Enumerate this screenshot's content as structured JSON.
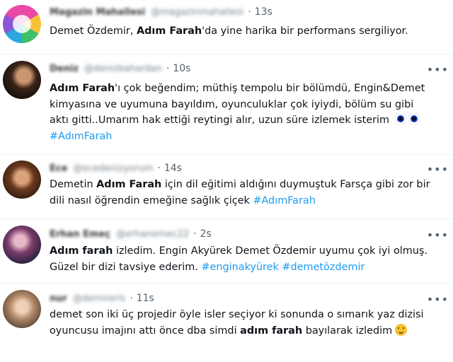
{
  "tweets": [
    {
      "name": "Magazin Mahallesi",
      "handle": "@magazinmahallesi",
      "time": "13s",
      "lines": [
        [
          {
            "t": "Demet Özdemir, "
          },
          {
            "t": "Adım Farah",
            "b": true
          },
          {
            "t": "'da yine harika bir performans sergiliyor."
          }
        ]
      ]
    },
    {
      "name": "Deniz",
      "handle": "@denizbahardan",
      "time": "10s",
      "lines": [
        [
          {
            "t": "Adım Farah",
            "b": true
          },
          {
            "t": "'ı çok beğendim; müthiş tempolu bir bölümdü, Engin&Demet"
          }
        ],
        [
          {
            "t": "kimyasına ve uyumuna bayıldım, oyunculuklar çok iyiydi, bölüm su gibi"
          }
        ],
        [
          {
            "t": "aktı gitti..Umarım hak ettiği reytingi alır, uzun süre izlemek isterim "
          },
          {
            "emoji": "nazar"
          },
          {
            "emoji": "nazar"
          }
        ],
        [
          {
            "t": "#AdımFarah",
            "tag": true
          }
        ]
      ]
    },
    {
      "name": "Ece",
      "handle": "@ecedenizyorum",
      "time": "14s",
      "lines": [
        [
          {
            "t": "Demetin "
          },
          {
            "t": "Adım Farah",
            "b": true
          },
          {
            "t": " için dil eğitimi aldığını duymuştuk Farsça gibi zor bir"
          }
        ],
        [
          {
            "t": "dili nasıl öğrendin emeğine sağlık çiçek "
          },
          {
            "t": "#AdımFarah",
            "tag": true
          }
        ]
      ]
    },
    {
      "name": "Erhan Emeç",
      "handle": "@erhanemec22",
      "time": "2s",
      "lines": [
        [
          {
            "t": "Adım farah",
            "b": true
          },
          {
            "t": " izledim. Engin Akyürek Demet Özdemir uyumu çok iyi olmuş."
          }
        ],
        [
          {
            "t": "Güzel bir dizi tavsiye ederim. "
          },
          {
            "t": "#enginakyürek",
            "tag": true
          },
          {
            "t": " "
          },
          {
            "t": "#demetözdemir",
            "tag": true
          }
        ]
      ]
    },
    {
      "name": "nur",
      "handle": "@demireris",
      "time": "11s",
      "lines": [
        [
          {
            "t": "demet son iki üç projedir öyle isler seçiyor ki sonunda o sımarık yaz dizisi"
          }
        ],
        [
          {
            "t": "oyuncusu imajını attı önce dba simdi "
          },
          {
            "t": "adım farah",
            "b": true
          },
          {
            "t": " bayılarak izledim"
          },
          {
            "emoji": "smile"
          }
        ]
      ]
    }
  ],
  "more_label": "•••",
  "separator": "·"
}
